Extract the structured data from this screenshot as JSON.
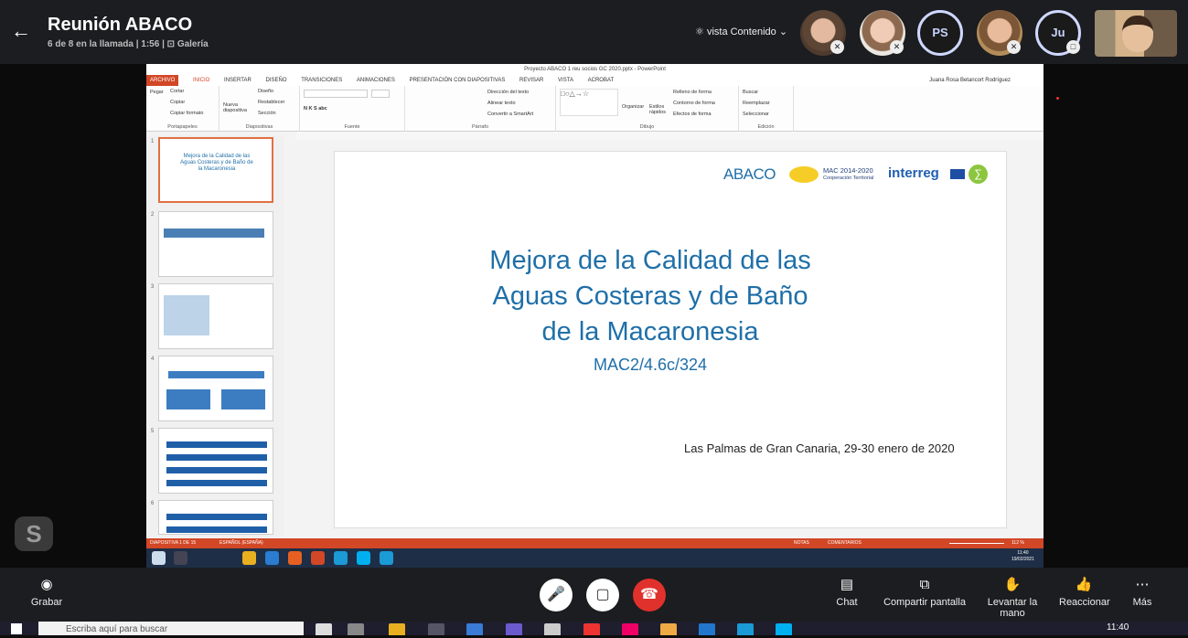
{
  "meeting": {
    "title": "Reunión ABACO",
    "subtitle": "6 de 8 en la llamada | 1:56 | ⊡ Galería",
    "view_label": "vista Contenido",
    "participants": [
      {
        "initials": "",
        "muted": true
      },
      {
        "initials": "",
        "muted": true
      },
      {
        "initials": "PS",
        "muted": false
      },
      {
        "initials": "",
        "muted": true
      },
      {
        "initials": "Ju",
        "muted": false
      }
    ]
  },
  "powerpoint": {
    "window_title": "Proyecto ABACO 1 reu socios GC 2020.pptx - PowerPoint",
    "user": "Juana Rosa Betancort Rodríguez",
    "tabs": [
      "ARCHIVO",
      "INICIO",
      "INSERTAR",
      "DISEÑO",
      "TRANSICIONES",
      "ANIMACIONES",
      "PRESENTACIÓN CON DIAPOSITIVAS",
      "REVISAR",
      "VISTA",
      "ACROBAT"
    ],
    "active_tab": "INICIO",
    "ribbon_groups": [
      "Portapapeles",
      "Diapositivas",
      "Fuente",
      "Párrafo",
      "Dibujo",
      "Edición"
    ],
    "ribbon_buttons": {
      "pegar": "Pegar",
      "cortar": "Cortar",
      "copiar": "Copiar",
      "copiar_formato": "Copiar formato",
      "nueva": "Nueva diapositiva",
      "diseno": "Diseño",
      "restablecer": "Restablecer",
      "seccion": "Sección",
      "direccion": "Dirección del texto",
      "alinear": "Alinear texto",
      "smartart": "Convertir a SmartArt",
      "organizar": "Organizar",
      "estilos": "Estilos rápidos",
      "relleno": "Relleno de forma",
      "contorno": "Contorno de forma",
      "efectos": "Efectos de forma",
      "buscar": "Buscar",
      "reemplazar": "Reemplazar",
      "seleccionar": "Seleccionar"
    },
    "thumb_numbers": [
      "1",
      "2",
      "3",
      "4",
      "5",
      "6"
    ],
    "thumb1_title": "Mejora de la Calidad de las Aguas Costeras y de Baño de la Macaronesia",
    "slide": {
      "title_line1": "Mejora de la Calidad de las",
      "title_line2": "Aguas Costeras y de Baño",
      "title_line3": "de la Macaronesia",
      "code": "MAC2/4.6c/324",
      "place_date": "Las Palmas de Gran Canaria, 29-30 enero de 2020",
      "logo_abaco": "ABACO",
      "logo_mac": "MAC 2014-2020",
      "logo_mac_sub": "Cooperación Territorial",
      "logo_interreg": "interreg"
    },
    "status": {
      "slide_count": "DIAPOSITIVA 1 DE 15",
      "language": "ESPAÑOL (ESPAÑA)",
      "notes": "NOTAS",
      "comments": "COMENTARIOS",
      "zoom": "112 %"
    },
    "win_time": "11:40",
    "win_date": "19/02/2021"
  },
  "controls": {
    "record": "Grabar",
    "chat": "Chat",
    "share": "Compartir pantalla",
    "raise_hand": "Levantar la mano",
    "react": "Reaccionar",
    "more": "Más"
  },
  "taskbar": {
    "search_placeholder": "Escriba aquí para buscar",
    "time": "11:40"
  }
}
